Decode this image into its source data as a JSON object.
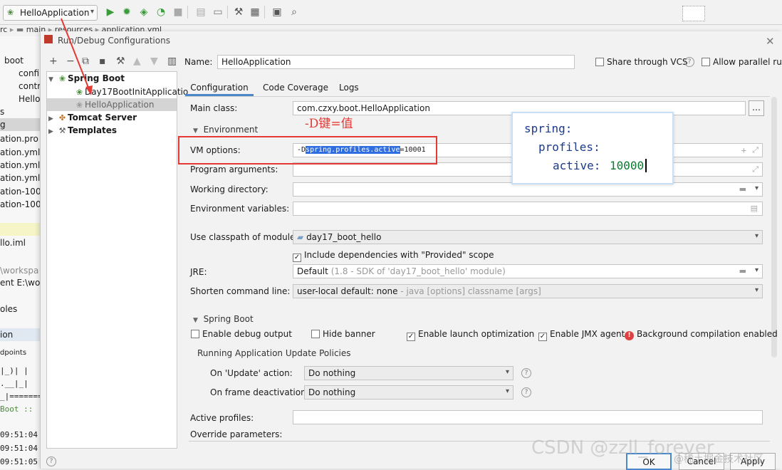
{
  "toolbar": {
    "run_config": "HelloApplication",
    "icons": [
      "run-icon",
      "debug-icon",
      "coverage-icon",
      "profile-icon",
      "stop-icon",
      "build-icon",
      "open-folder-icon",
      "wrench-icon",
      "project-structure-icon",
      "window-icon",
      "search-icon"
    ]
  },
  "breadcrumb": [
    "rc",
    "main",
    "resources",
    "application.yml"
  ],
  "project_panel": {
    "lines": [
      "boot",
      "confi",
      "contr",
      "Hello",
      "s",
      "g",
      "ation.pro",
      "ation.yml",
      "ation.yml",
      "ation.yml",
      "ation-100",
      "ation-100",
      "llo.iml",
      "\\workspa",
      "ent E:\\wo",
      "oles",
      "ion",
      "dpoints",
      "|_)| |",
      ".__|_|",
      "_|=======",
      "Boot ::",
      "09:51:04",
      "09:51:04",
      "09:51:05"
    ]
  },
  "dialog": {
    "title": "Run/Debug Configurations",
    "tree": {
      "groups": [
        {
          "label": "Spring Boot",
          "children": [
            "Day17BootInitApplicatio",
            "HelloApplication"
          ]
        },
        {
          "label": "Tomcat Server"
        },
        {
          "label": "Templates"
        }
      ]
    },
    "name_label": "Name:",
    "name_value": "HelloApplication",
    "share_vcs": "Share through VCS",
    "allow_parallel": "Allow parallel run",
    "tabs": [
      "Configuration",
      "Code Coverage",
      "Logs"
    ],
    "main_class_label": "Main class:",
    "main_class_value": "com.czxy.boot.HelloApplication",
    "environment_label": "Environment",
    "vm_options_label": "VM options:",
    "vm_options_prefix": "-D",
    "vm_options_highlight": "spring.profiles.active",
    "vm_options_suffix": "=10001",
    "program_args_label": "Program arguments:",
    "working_dir_label": "Working directory:",
    "env_vars_label": "Environment variables:",
    "classpath_label": "Use classpath of module:",
    "classpath_value": "day17_boot_hello",
    "include_deps": "Include dependencies with \"Provided\" scope",
    "jre_label": "JRE:",
    "jre_value": "Default",
    "jre_hint": "(1.8 - SDK of 'day17_boot_hello' module)",
    "shorten_label": "Shorten command line:",
    "shorten_value": "user-local default: none",
    "shorten_hint": "- java [options] classname [args]",
    "spring_boot_section": "Spring Boot",
    "enable_debug": "Enable debug output",
    "hide_banner": "Hide banner",
    "enable_launch": "Enable launch optimization",
    "enable_jmx": "Enable JMX agent",
    "bg_compile": "Background compilation enabled",
    "update_policies": "Running Application Update Policies",
    "on_update_label": "On 'Update' action:",
    "on_update_value": "Do nothing",
    "on_frame_label": "On frame deactivation:",
    "on_frame_value": "Do nothing",
    "active_profiles_label": "Active profiles:",
    "override_label": "Override parameters:",
    "ok": "OK",
    "cancel": "Cancel",
    "apply": "Apply"
  },
  "annotation": {
    "text": "-D键=值",
    "yaml": [
      "spring:",
      "profiles:",
      "active:"
    ],
    "yaml_value": "10000",
    "color": "#e53935"
  },
  "watermark": {
    "main": "CSDN @zzll_forever",
    "sub": "@稀土掘金技术社区"
  }
}
